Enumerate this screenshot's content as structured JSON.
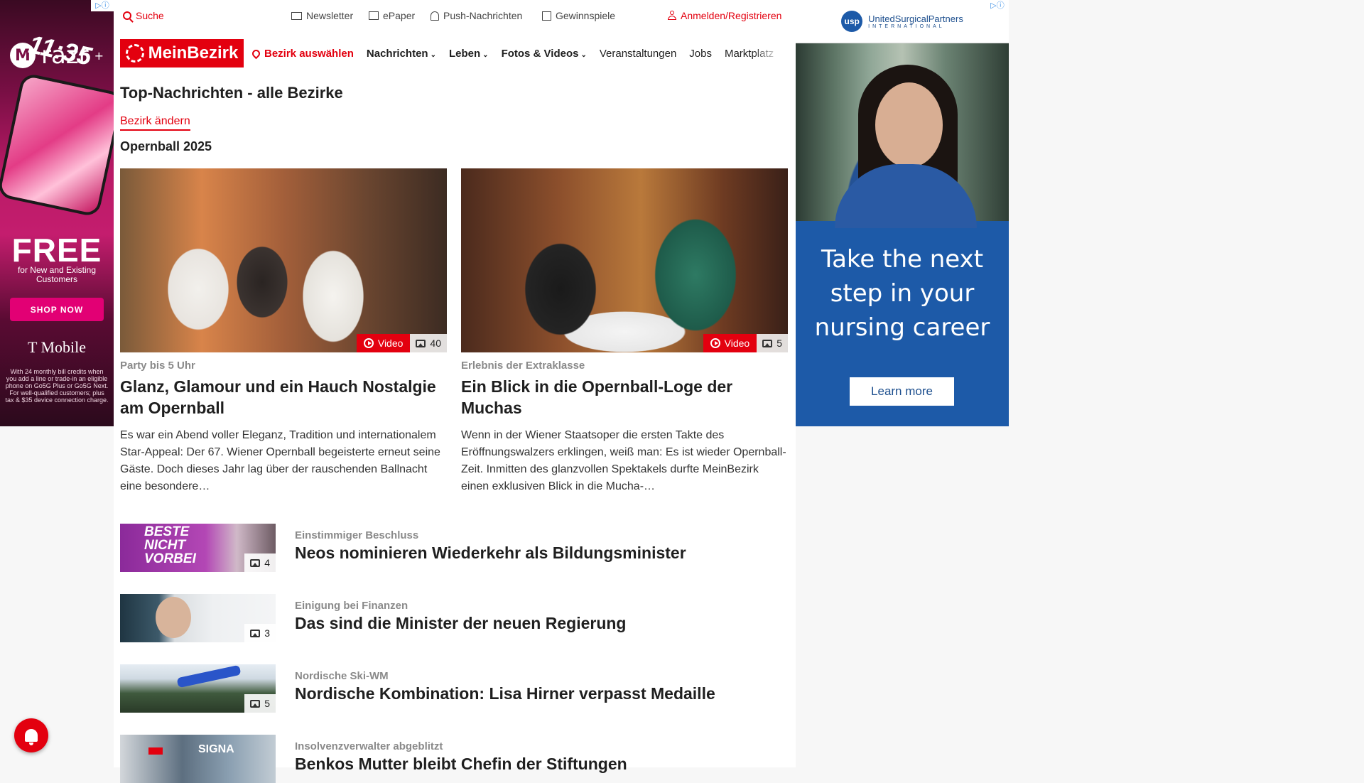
{
  "left_ad": {
    "brand": "razr",
    "plus": "+",
    "phone_time": "11:35",
    "headline": "FREE",
    "subline": "for New and Existing Customers",
    "cta": "SHOP NOW",
    "advertiser": "T Mobile",
    "fineprint": "With 24 monthly bill credits when you add a line or trade-in an eligible phone on Go5G Plus or Go5G Next. For well-qualified customers; plus tax & $35 device connection charge."
  },
  "right_ad": {
    "logo_text": "UnitedSurgicalPartners",
    "logo_sub": "INTERNATIONAL",
    "headline": "Take the next step in your nursing career",
    "cta": "Learn more"
  },
  "topbar": {
    "search": "Suche",
    "newsletter": "Newsletter",
    "epaper": "ePaper",
    "push": "Push-Nachrichten",
    "gewinnspiele": "Gewinnspiele",
    "login": "Anmelden/Registrieren"
  },
  "nav": {
    "logo": "MeinBezirk",
    "bezirk": "Bezirk auswählen",
    "items": [
      "Nachrichten",
      "Leben",
      "Fotos & Videos",
      "Veranstaltungen",
      "Jobs",
      "Marktplatz"
    ]
  },
  "section": {
    "title": "Top-Nachrichten - alle Bezirke",
    "change": "Bezirk ändern",
    "subtitle": "Opernball 2025"
  },
  "cards": [
    {
      "kicker": "Party bis 5 Uhr",
      "headline": "Glanz, Glamour und ein Hauch Nostalgie am Opernball",
      "teaser": "Es war ein Abend voller Eleganz, Tradition und internationalem Star-Appeal: Der 67. Wiener Opernball begeisterte erneut seine Gäste. Doch dieses Jahr lag über der rauschenden Ballnacht eine besondere…",
      "video_label": "Video",
      "count": "40"
    },
    {
      "kicker": "Erlebnis der Extraklasse",
      "headline": "Ein Blick in die Opernball-Loge der Muchas",
      "teaser": "Wenn in der Wiener Staatsoper die ersten Takte des Eröffnungswalzers erklingen, weiß man: Es ist wieder Opernball-Zeit. Inmitten des glanzvollen Spektakels durfte MeinBezirk einen exklusiven Blick in die Mucha-…",
      "video_label": "Video",
      "count": "5"
    }
  ],
  "list": [
    {
      "kicker": "Einstimmiger Beschluss",
      "headline": "Neos nominieren Wiederkehr als Bildungsminister",
      "count": "4",
      "thumb_text": "BESTE NICHT VORBEI"
    },
    {
      "kicker": "Einigung bei Finanzen",
      "headline": "Das sind die Minister der neuen Regierung",
      "count": "3"
    },
    {
      "kicker": "Nordische Ski-WM",
      "headline": "Nordische Kombination: Lisa Hirner verpasst Medaille",
      "count": "5"
    },
    {
      "kicker": "Insolvenzverwalter abgeblitzt",
      "headline": "Benkos Mutter bleibt Chefin der Stiftungen",
      "thumb_text": "SIGNA"
    }
  ],
  "colors": {
    "brand_red": "#e3000f",
    "ad_blue": "#1d5aa8",
    "tmobile_magenta": "#e20074"
  }
}
